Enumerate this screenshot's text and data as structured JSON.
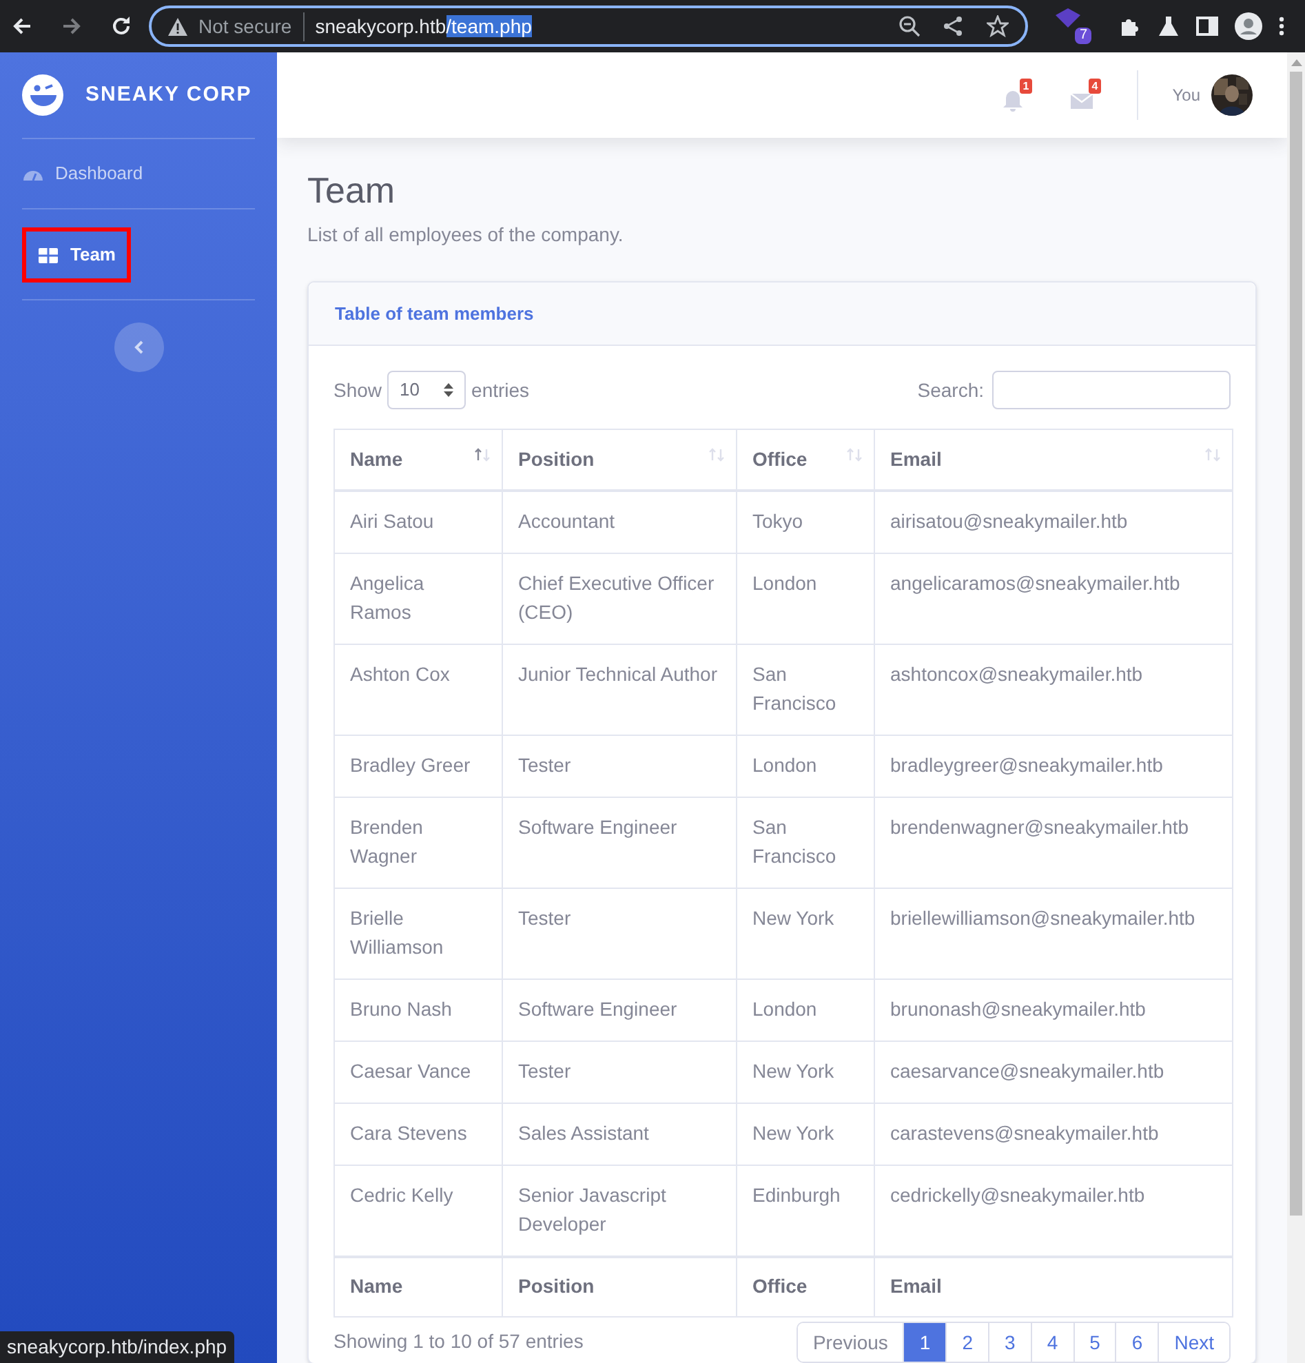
{
  "browser": {
    "security_label": "Not secure",
    "url_host": "sneakycorp.htb",
    "url_path": "/team.php",
    "extension_badge": "7"
  },
  "sidebar": {
    "brand": "SNEAKY CORP",
    "items": [
      {
        "label": "Dashboard",
        "selected": false,
        "outlined": false
      },
      {
        "label": "Team",
        "selected": true,
        "outlined": true
      }
    ]
  },
  "topbar": {
    "alerts_count": "1",
    "messages_count": "4",
    "user_name": "You"
  },
  "page": {
    "title": "Team",
    "subtitle": "List of all employees of the company."
  },
  "card": {
    "title": "Table of team members",
    "show_label": "Show",
    "entries_value": "10",
    "entries_label": "entries",
    "search_label": "Search:",
    "columns": [
      {
        "label": "Name",
        "sorted": true
      },
      {
        "label": "Position",
        "sorted": false
      },
      {
        "label": "Office",
        "sorted": false
      },
      {
        "label": "Email",
        "sorted": false
      }
    ],
    "rows": [
      [
        "Airi Satou",
        "Accountant",
        "Tokyo",
        "airisatou@sneakymailer.htb"
      ],
      [
        "Angelica Ramos",
        "Chief Executive Officer (CEO)",
        "London",
        "angelicaramos@sneakymailer.htb"
      ],
      [
        "Ashton Cox",
        "Junior Technical Author",
        "San Francisco",
        "ashtoncox@sneakymailer.htb"
      ],
      [
        "Bradley Greer",
        "Tester",
        "London",
        "bradleygreer@sneakymailer.htb"
      ],
      [
        "Brenden Wagner",
        "Software Engineer",
        "San Francisco",
        "brendenwagner@sneakymailer.htb"
      ],
      [
        "Brielle Williamson",
        "Tester",
        "New York",
        "briellewilliamson@sneakymailer.htb"
      ],
      [
        "Bruno Nash",
        "Software Engineer",
        "London",
        "brunonash@sneakymailer.htb"
      ],
      [
        "Caesar Vance",
        "Tester",
        "New York",
        "caesarvance@sneakymailer.htb"
      ],
      [
        "Cara Stevens",
        "Sales Assistant",
        "New York",
        "carastevens@sneakymailer.htb"
      ],
      [
        "Cedric Kelly",
        "Senior Javascript Developer",
        "Edinburgh",
        "cedrickelly@sneakymailer.htb"
      ]
    ],
    "footer_columns": [
      "Name",
      "Position",
      "Office",
      "Email"
    ],
    "info": "Showing 1 to 10 of 57 entries",
    "pagination": [
      {
        "label": "Previous",
        "selected": false
      },
      {
        "label": "1",
        "selected": true
      },
      {
        "label": "2",
        "selected": false
      },
      {
        "label": "3",
        "selected": false
      },
      {
        "label": "4",
        "selected": false
      },
      {
        "label": "5",
        "selected": false
      },
      {
        "label": "6",
        "selected": false
      },
      {
        "label": "Next",
        "selected": false
      }
    ]
  },
  "status_url": "sneakycorp.htb/index.php"
}
